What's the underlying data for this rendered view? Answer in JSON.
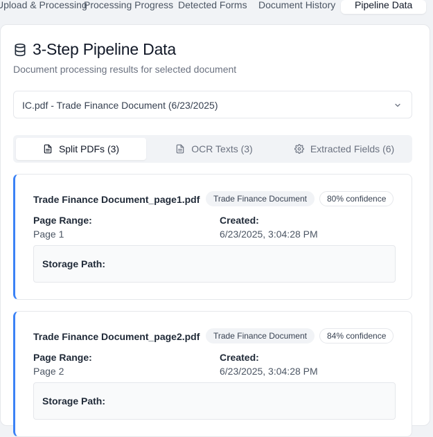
{
  "top_tabs": [
    {
      "label": "Upload & Processing"
    },
    {
      "label": "Processing Progress"
    },
    {
      "label": "Detected Forms"
    },
    {
      "label": "Document History"
    },
    {
      "label": "Pipeline Data",
      "active": true
    }
  ],
  "header": {
    "title": "3-Step Pipeline Data",
    "subtitle": "Document processing results for selected document"
  },
  "document_select": {
    "value": "IC.pdf - Trade Finance Document (6/23/2025)"
  },
  "sub_tabs": [
    {
      "label": "Split PDFs (3)",
      "icon": "file-text-icon",
      "active": true
    },
    {
      "label": "OCR Texts (3)",
      "icon": "file-text-icon"
    },
    {
      "label": "Extracted Fields (6)",
      "icon": "gear-icon"
    }
  ],
  "items": [
    {
      "name": "Trade Finance Document_page1.pdf",
      "type_badge": "Trade Finance Document",
      "confidence": "80% confidence",
      "page_range_label": "Page Range:",
      "page_range": "Page 1",
      "created_label": "Created:",
      "created": "6/23/2025, 3:04:28 PM",
      "storage_label": "Storage Path:"
    },
    {
      "name": "Trade Finance Document_page2.pdf",
      "type_badge": "Trade Finance Document",
      "confidence": "84% confidence",
      "page_range_label": "Page Range:",
      "page_range": "Page 2",
      "created_label": "Created:",
      "created": "6/23/2025, 3:04:28 PM",
      "storage_label": "Storage Path:"
    }
  ],
  "colors": {
    "accent": "#3b82f6",
    "muted_bg": "#f1f3f6"
  }
}
